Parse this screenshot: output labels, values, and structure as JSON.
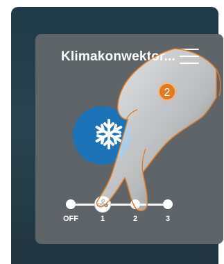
{
  "header": {
    "title": "Klimakonwektor...",
    "menu_icon": "hamburger-menu-icon"
  },
  "mode": {
    "icon": "snowflake-icon",
    "color": "#1d73b8"
  },
  "fan_speed": {
    "icon": "fan-icon",
    "selected_index": 1,
    "levels": [
      "OFF",
      "1",
      "2",
      "3"
    ]
  },
  "step_badge": {
    "label": "2",
    "color": "#e07a22"
  }
}
